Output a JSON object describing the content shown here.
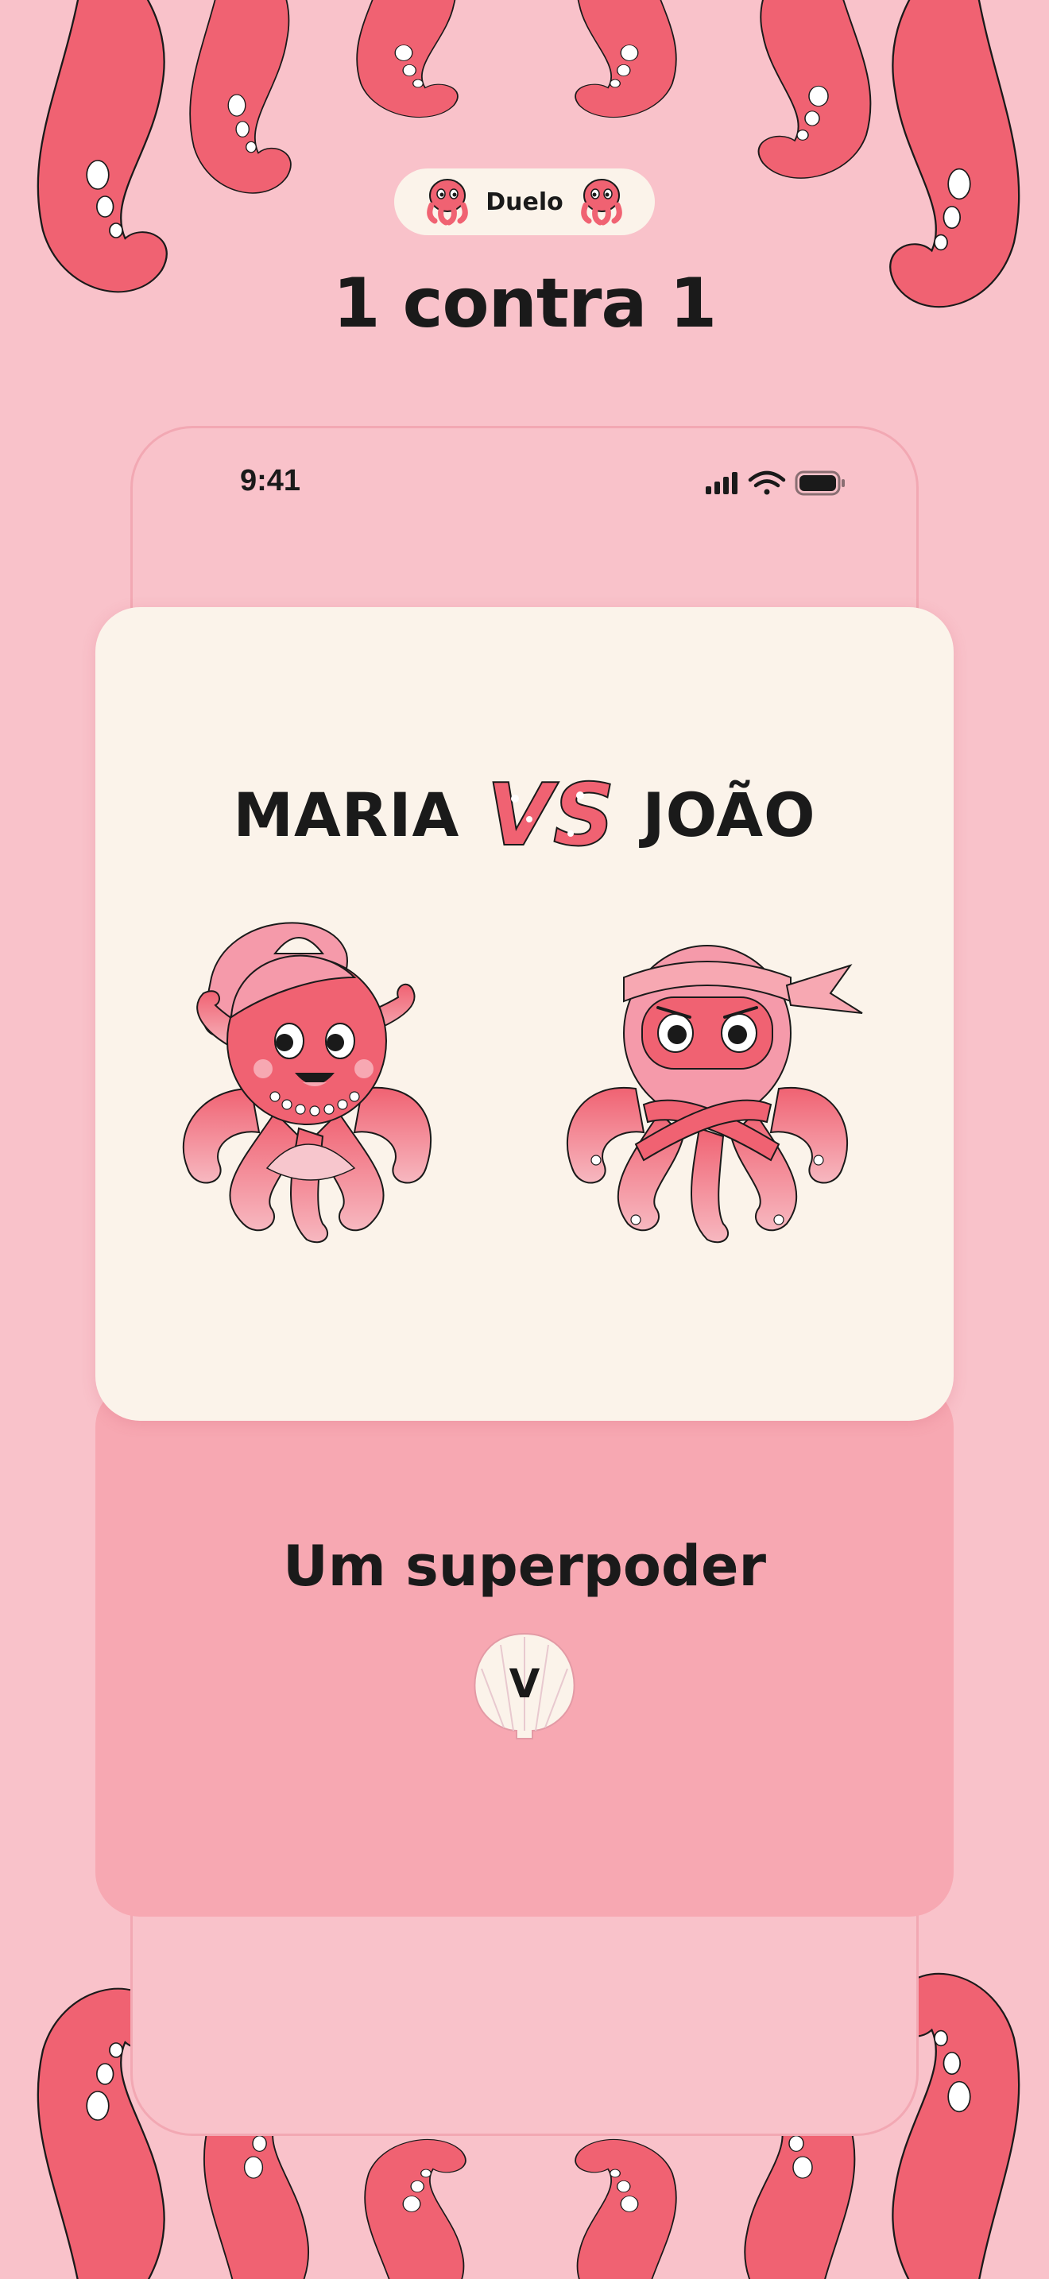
{
  "header": {
    "badge_label": "Duelo",
    "title": "1 contra 1"
  },
  "status_bar": {
    "time": "9:41",
    "icons": [
      "signal-icon",
      "wifi-icon",
      "battery-icon"
    ]
  },
  "duel": {
    "player_left": "MARIA",
    "vs_text": "VS",
    "player_right": "JOÃO"
  },
  "result": {
    "ability": "Um superpoder",
    "shell_letter": "V"
  },
  "colors": {
    "background": "#f9c2ca",
    "accent": "#f06272",
    "card": "#fbf3ea",
    "panel": "#f7a8b2"
  }
}
